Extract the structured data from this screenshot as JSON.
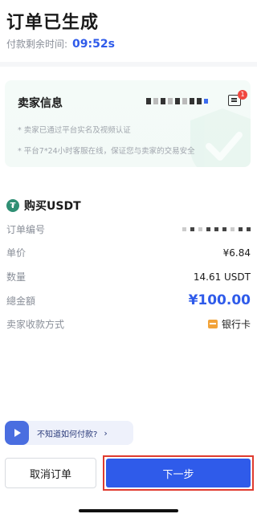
{
  "header": {
    "title": "订单已生成",
    "timer_label": "付款剩余时间:",
    "timer_value": "09:52s"
  },
  "seller": {
    "title": "卖家信息",
    "chat_badge": "1",
    "notes": [
      "* 卖家已通过平台实名及视频认证",
      "* 平台7*24小时客服在线，保证您与卖家的交易安全"
    ]
  },
  "order": {
    "title": "购买USDT",
    "coin_icon": "tether-icon",
    "rows": {
      "order_no_label": "订单编号",
      "price_label": "单价",
      "price_value": "¥6.84",
      "qty_label": "数量",
      "qty_value": "14.61 USDT",
      "total_label": "總金額",
      "total_value": "¥100.00",
      "pay_label": "卖家收款方式",
      "pay_value": "银行卡"
    }
  },
  "help": {
    "text": "不知道如何付款?",
    "chevron": "›"
  },
  "actions": {
    "cancel_label": "取消订单",
    "next_label": "下一步"
  },
  "colors": {
    "accent": "#2f5bea",
    "highlight_border": "#e03b2f",
    "tether": "#2f8f74"
  }
}
